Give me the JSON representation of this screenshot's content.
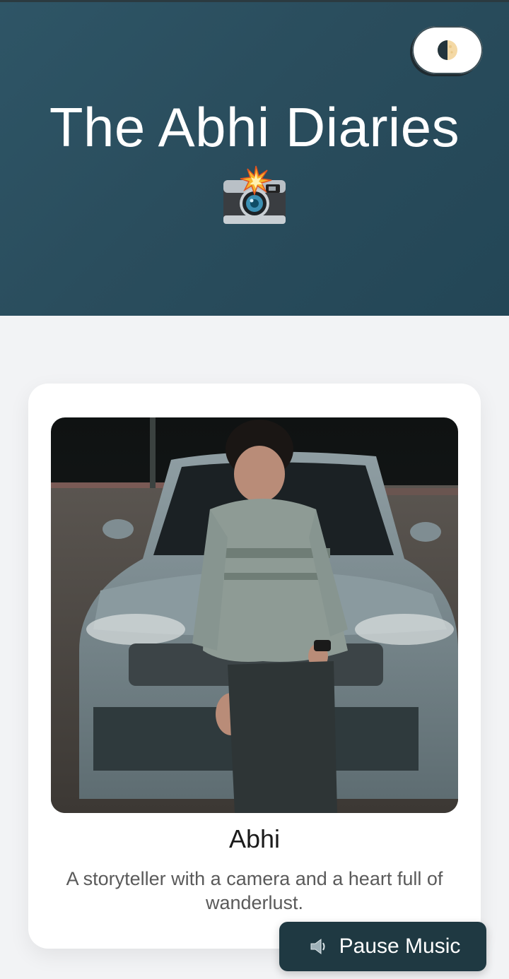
{
  "header": {
    "title": "The Abhi Diaries",
    "title_emoji": "camera-with-flash-icon",
    "background": "#2a4d5d"
  },
  "theme_toggle": {
    "icon": "half-moon-icon"
  },
  "profile": {
    "name": "Abhi",
    "bio": "A storyteller with a camera and a heart full of wanderlust.",
    "photo": "person-leaning-on-car-photo"
  },
  "music": {
    "label": "Pause Music",
    "icon": "speaker-icon"
  },
  "colors": {
    "page_bg": "#f2f3f5",
    "card_bg": "#ffffff",
    "button_bg": "#1f3942"
  }
}
